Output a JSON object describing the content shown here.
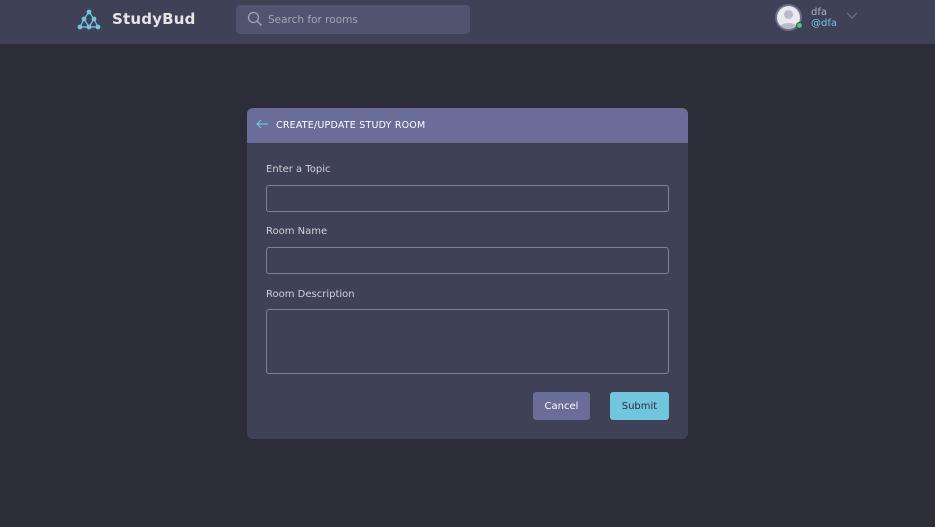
{
  "header": {
    "brand": "StudyBud",
    "logo_icon": "studybud-logo-icon",
    "search": {
      "placeholder": "Search for rooms",
      "value": ""
    },
    "user": {
      "name": "dfa",
      "handle": "@dfa",
      "status": "online"
    }
  },
  "form": {
    "title": "CREATE/UPDATE STUDY ROOM",
    "back_icon": "arrow-left-icon",
    "fields": [
      {
        "label": "Enter a Topic",
        "value": ""
      },
      {
        "label": "Room Name",
        "value": ""
      },
      {
        "label": "Room Description",
        "value": ""
      }
    ],
    "cancel_label": "Cancel",
    "submit_label": "Submit"
  },
  "colors": {
    "background": "#2d2d39",
    "header": "#3f4156",
    "card_header": "#696d97",
    "accent": "#71c6dd",
    "online": "#48c774"
  }
}
